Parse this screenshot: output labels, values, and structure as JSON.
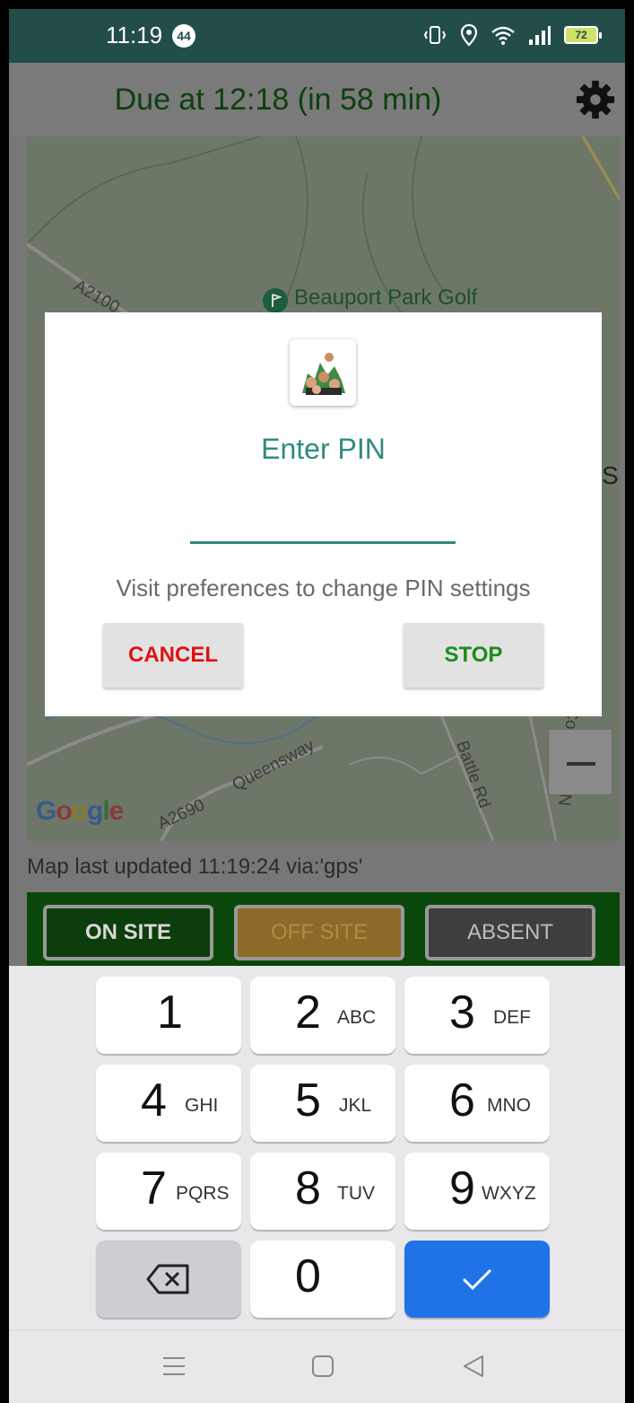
{
  "status_bar": {
    "time": "11:19",
    "notification_count": "44",
    "battery": "72"
  },
  "header": {
    "due_text": "Due at 12:18 (in 58 min)",
    "settings_icon": "gear-icon"
  },
  "map": {
    "labels": [
      "A2100",
      "Beauport Park Golf",
      "Queensway",
      "A2690",
      "Battle Rd",
      "Combe Rd N",
      "S"
    ],
    "logo": "Google",
    "status": "Map last updated 11:19:24 via:'gps'"
  },
  "attendance": {
    "on_site": "ON SITE",
    "off_site": "OFF SITE",
    "absent": "ABSENT"
  },
  "dialog": {
    "title": "Enter PIN",
    "pin_value": "",
    "hint": "Visit preferences to change PIN settings",
    "cancel_label": "CANCEL",
    "stop_label": "STOP"
  },
  "keyboard": {
    "keys": [
      {
        "digit": "1",
        "letters": ""
      },
      {
        "digit": "2",
        "letters": "ABC"
      },
      {
        "digit": "3",
        "letters": "DEF"
      },
      {
        "digit": "4",
        "letters": "GHI"
      },
      {
        "digit": "5",
        "letters": "JKL"
      },
      {
        "digit": "6",
        "letters": "MNO"
      },
      {
        "digit": "7",
        "letters": "PQRS"
      },
      {
        "digit": "8",
        "letters": "TUV"
      },
      {
        "digit": "9",
        "letters": "WXYZ"
      },
      {
        "digit": "0",
        "letters": ""
      }
    ],
    "backspace_icon": "backspace-icon",
    "done_icon": "checkmark-icon"
  },
  "nav": {
    "menu_icon": "menu-icon",
    "home_icon": "home-square-icon",
    "back_icon": "back-triangle-icon"
  },
  "colors": {
    "status_bar": "#234d48",
    "accent": "#2f8c7c",
    "cancel": "#e01010",
    "stop": "#1a8c1a",
    "keyboard_done": "#1f73e6"
  }
}
